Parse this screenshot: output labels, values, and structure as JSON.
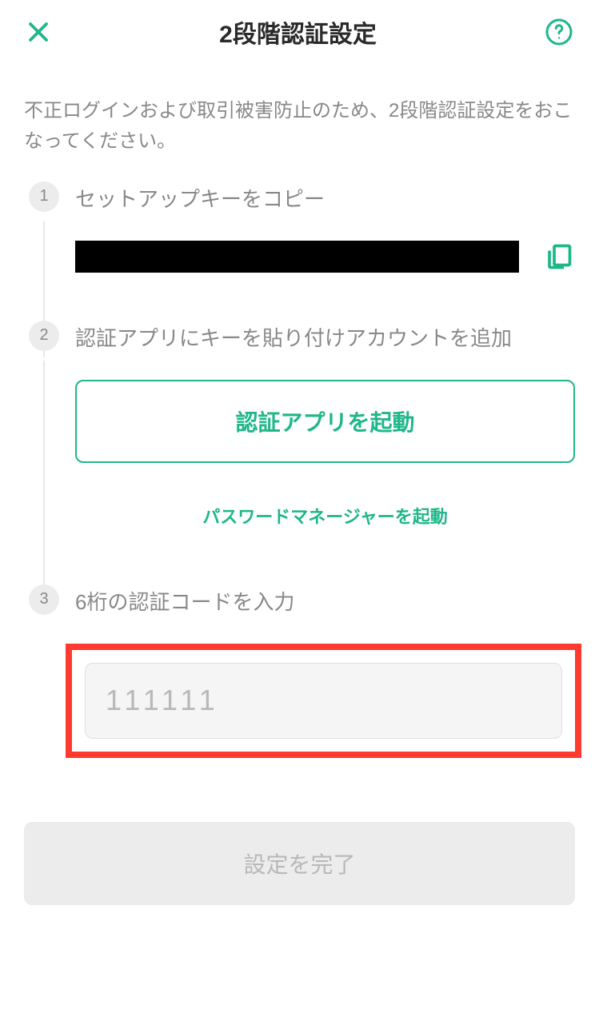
{
  "header": {
    "title": "2段階認証設定"
  },
  "description": "不正ログインおよび取引被害防止のため、2段階認証設定をおこなってください。",
  "steps": {
    "s1": {
      "number": "1",
      "title": "セットアップキーをコピー"
    },
    "s2": {
      "number": "2",
      "title": "認証アプリにキーを貼り付けアカウントを追加",
      "auth_app_button": "認証アプリを起動",
      "password_manager_link": "パスワードマネージャーを起動"
    },
    "s3": {
      "number": "3",
      "title": "6桁の認証コードを入力",
      "placeholder": "111111"
    }
  },
  "submit_button": "設定を完了",
  "colors": {
    "accent": "#1fb789",
    "highlight_border": "#ff3b30"
  }
}
